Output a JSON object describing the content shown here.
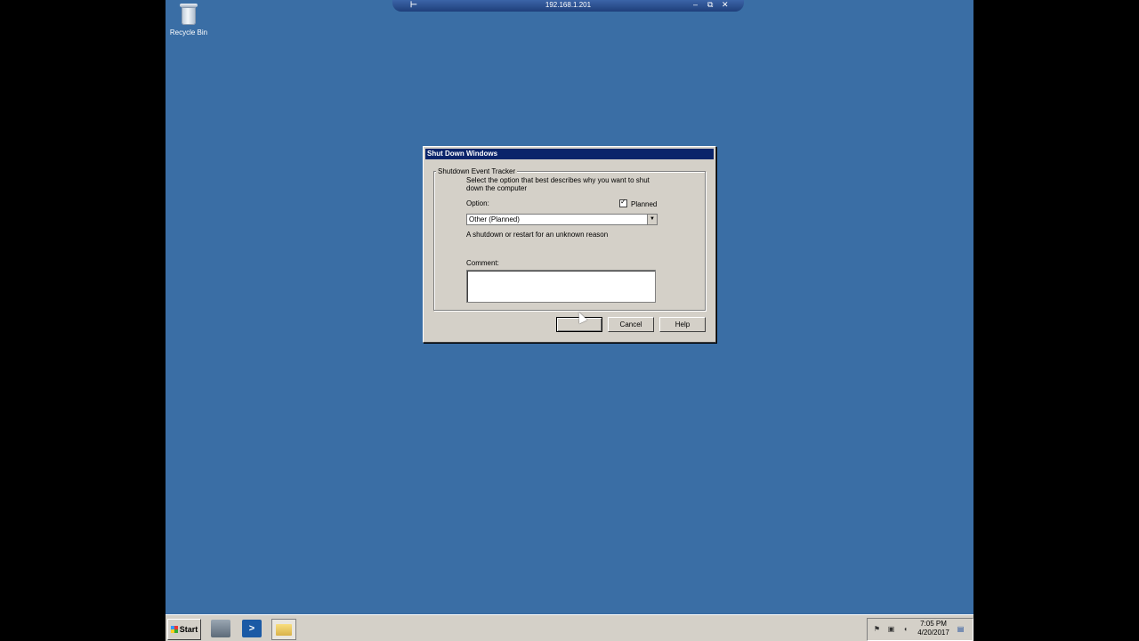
{
  "rdp_bar": {
    "title": "192.168.1.201",
    "pin_icon": "pin-icon",
    "minimize_icon": "minimize-icon",
    "restore_icon": "restore-icon",
    "close_icon": "close-icon"
  },
  "desktop": {
    "recycle_bin_label": "Recycle Bin"
  },
  "dialog": {
    "title": "Shut Down Windows",
    "group_title": "Shutdown Event Tracker",
    "description": "Select the option that best describes why you want to shut down the computer",
    "option_label": "Option:",
    "planned_label": "Planned",
    "planned_checked": true,
    "option_value": "Other (Planned)",
    "reason_text": "A shutdown or restart for an unknown reason",
    "comment_label": "Comment:",
    "comment_value": "",
    "ok_label": "",
    "cancel_label": "Cancel",
    "help_label": "Help"
  },
  "taskbar": {
    "start_label": "Start",
    "clock_time": "7:05 PM",
    "clock_date": "4/20/2017",
    "pinned": [
      "server-manager-icon",
      "powershell-icon",
      "explorer-folder-icon"
    ]
  }
}
